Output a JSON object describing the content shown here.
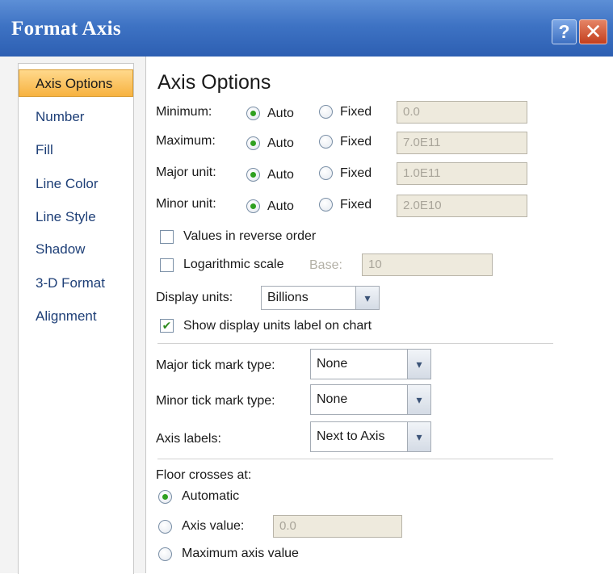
{
  "window": {
    "title": "Format Axis",
    "help_label": "?",
    "close_label": "✕"
  },
  "nav": {
    "items": [
      {
        "label": "Axis Options",
        "selected": true
      },
      {
        "label": "Number"
      },
      {
        "label": "Fill"
      },
      {
        "label": "Line Color"
      },
      {
        "label": "Line Style"
      },
      {
        "label": "Shadow"
      },
      {
        "label": "3-D Format"
      },
      {
        "label": "Alignment"
      }
    ]
  },
  "axis_options": {
    "heading": "Axis Options",
    "auto_label": "Auto",
    "fixed_label": "Fixed",
    "minimum": {
      "label": "Minimum:",
      "mode": "auto",
      "value": "0.0"
    },
    "maximum": {
      "label": "Maximum:",
      "mode": "auto",
      "value": "7.0E11"
    },
    "major_unit": {
      "label": "Major unit:",
      "mode": "auto",
      "value": "1.0E11"
    },
    "minor_unit": {
      "label": "Minor unit:",
      "mode": "auto",
      "value": "2.0E10"
    },
    "reverse_order": {
      "label": "Values in reverse order",
      "checked": false
    },
    "log_scale": {
      "label": "Logarithmic scale",
      "checked": false,
      "base_label": "Base:",
      "base_value": "10"
    },
    "display_units": {
      "label": "Display units:",
      "value": "Billions"
    },
    "show_units_label": {
      "label": "Show display units label on chart",
      "checked": true
    },
    "major_tick": {
      "label": "Major tick mark type:",
      "value": "None"
    },
    "minor_tick": {
      "label": "Minor tick mark type:",
      "value": "None"
    },
    "axis_labels": {
      "label": "Axis labels:",
      "value": "Next to Axis"
    },
    "floor_crosses": {
      "label": "Floor crosses at:",
      "automatic_label": "Automatic",
      "axis_value_label": "Axis value:",
      "axis_value": "0.0",
      "maximum_label": "Maximum axis value",
      "selected": "automatic"
    }
  },
  "icons": {
    "check": "✔",
    "dropdown": "▾"
  },
  "colors": {
    "title_bar": "#3e73c4",
    "selected_nav": "#f7b240",
    "radio_dot": "#2fa01f",
    "close_button": "#c33f1e"
  }
}
